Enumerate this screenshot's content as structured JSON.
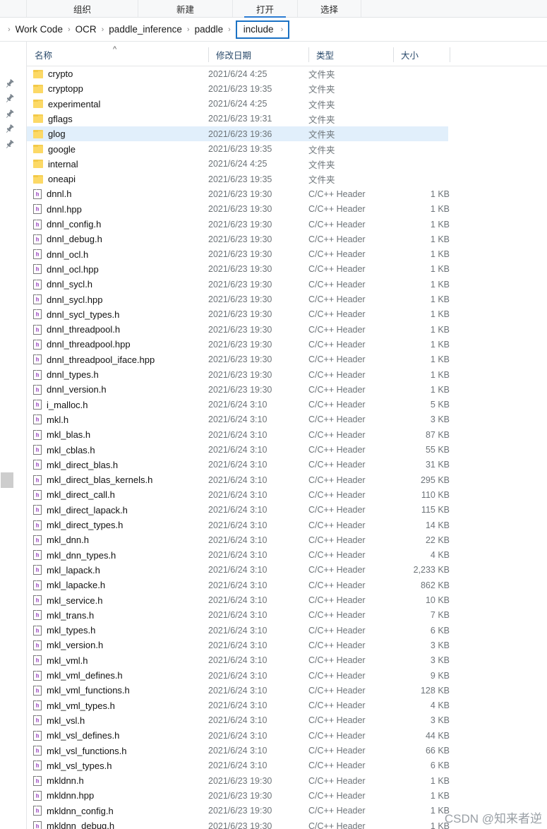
{
  "ribbon": {
    "tabs": [
      {
        "label": "组织",
        "active": false
      },
      {
        "label": "新建",
        "active": false
      },
      {
        "label": "打开",
        "active": true
      },
      {
        "label": "选择",
        "active": false
      }
    ]
  },
  "breadcrumb": {
    "separator": "›",
    "items": [
      "Work Code",
      "OCR",
      "paddle_inference",
      "paddle"
    ],
    "current": "include",
    "highlight_color": "#1b72c4"
  },
  "columns": {
    "name": "名称",
    "date": "修改日期",
    "type": "类型",
    "size": "大小",
    "sort_caret": "^"
  },
  "left_rail": {
    "pin_icon": "pin-icon",
    "pin_count": 5
  },
  "selection": {
    "row": "glog",
    "color": "#e1effb"
  },
  "types": {
    "folder": "文件夹",
    "header": "C/C++ Header"
  },
  "rows": [
    {
      "name": "crypto",
      "date": "2021/6/24 4:25",
      "type": "文件夹",
      "size": "",
      "kind": "folder"
    },
    {
      "name": "cryptopp",
      "date": "2021/6/23 19:35",
      "type": "文件夹",
      "size": "",
      "kind": "folder"
    },
    {
      "name": "experimental",
      "date": "2021/6/24 4:25",
      "type": "文件夹",
      "size": "",
      "kind": "folder"
    },
    {
      "name": "gflags",
      "date": "2021/6/23 19:31",
      "type": "文件夹",
      "size": "",
      "kind": "folder"
    },
    {
      "name": "glog",
      "date": "2021/6/23 19:36",
      "type": "文件夹",
      "size": "",
      "kind": "folder",
      "selected": true
    },
    {
      "name": "google",
      "date": "2021/6/23 19:35",
      "type": "文件夹",
      "size": "",
      "kind": "folder"
    },
    {
      "name": "internal",
      "date": "2021/6/24 4:25",
      "type": "文件夹",
      "size": "",
      "kind": "folder"
    },
    {
      "name": "oneapi",
      "date": "2021/6/23 19:35",
      "type": "文件夹",
      "size": "",
      "kind": "folder"
    },
    {
      "name": "dnnl.h",
      "date": "2021/6/23 19:30",
      "type": "C/C++ Header",
      "size": "1 KB",
      "kind": "header"
    },
    {
      "name": "dnnl.hpp",
      "date": "2021/6/23 19:30",
      "type": "C/C++ Header",
      "size": "1 KB",
      "kind": "header"
    },
    {
      "name": "dnnl_config.h",
      "date": "2021/6/23 19:30",
      "type": "C/C++ Header",
      "size": "1 KB",
      "kind": "header"
    },
    {
      "name": "dnnl_debug.h",
      "date": "2021/6/23 19:30",
      "type": "C/C++ Header",
      "size": "1 KB",
      "kind": "header"
    },
    {
      "name": "dnnl_ocl.h",
      "date": "2021/6/23 19:30",
      "type": "C/C++ Header",
      "size": "1 KB",
      "kind": "header"
    },
    {
      "name": "dnnl_ocl.hpp",
      "date": "2021/6/23 19:30",
      "type": "C/C++ Header",
      "size": "1 KB",
      "kind": "header"
    },
    {
      "name": "dnnl_sycl.h",
      "date": "2021/6/23 19:30",
      "type": "C/C++ Header",
      "size": "1 KB",
      "kind": "header"
    },
    {
      "name": "dnnl_sycl.hpp",
      "date": "2021/6/23 19:30",
      "type": "C/C++ Header",
      "size": "1 KB",
      "kind": "header"
    },
    {
      "name": "dnnl_sycl_types.h",
      "date": "2021/6/23 19:30",
      "type": "C/C++ Header",
      "size": "1 KB",
      "kind": "header"
    },
    {
      "name": "dnnl_threadpool.h",
      "date": "2021/6/23 19:30",
      "type": "C/C++ Header",
      "size": "1 KB",
      "kind": "header"
    },
    {
      "name": "dnnl_threadpool.hpp",
      "date": "2021/6/23 19:30",
      "type": "C/C++ Header",
      "size": "1 KB",
      "kind": "header"
    },
    {
      "name": "dnnl_threadpool_iface.hpp",
      "date": "2021/6/23 19:30",
      "type": "C/C++ Header",
      "size": "1 KB",
      "kind": "header"
    },
    {
      "name": "dnnl_types.h",
      "date": "2021/6/23 19:30",
      "type": "C/C++ Header",
      "size": "1 KB",
      "kind": "header"
    },
    {
      "name": "dnnl_version.h",
      "date": "2021/6/23 19:30",
      "type": "C/C++ Header",
      "size": "1 KB",
      "kind": "header"
    },
    {
      "name": "i_malloc.h",
      "date": "2021/6/24 3:10",
      "type": "C/C++ Header",
      "size": "5 KB",
      "kind": "header"
    },
    {
      "name": "mkl.h",
      "date": "2021/6/24 3:10",
      "type": "C/C++ Header",
      "size": "3 KB",
      "kind": "header"
    },
    {
      "name": "mkl_blas.h",
      "date": "2021/6/24 3:10",
      "type": "C/C++ Header",
      "size": "87 KB",
      "kind": "header"
    },
    {
      "name": "mkl_cblas.h",
      "date": "2021/6/24 3:10",
      "type": "C/C++ Header",
      "size": "55 KB",
      "kind": "header"
    },
    {
      "name": "mkl_direct_blas.h",
      "date": "2021/6/24 3:10",
      "type": "C/C++ Header",
      "size": "31 KB",
      "kind": "header"
    },
    {
      "name": "mkl_direct_blas_kernels.h",
      "date": "2021/6/24 3:10",
      "type": "C/C++ Header",
      "size": "295 KB",
      "kind": "header"
    },
    {
      "name": "mkl_direct_call.h",
      "date": "2021/6/24 3:10",
      "type": "C/C++ Header",
      "size": "110 KB",
      "kind": "header"
    },
    {
      "name": "mkl_direct_lapack.h",
      "date": "2021/6/24 3:10",
      "type": "C/C++ Header",
      "size": "115 KB",
      "kind": "header"
    },
    {
      "name": "mkl_direct_types.h",
      "date": "2021/6/24 3:10",
      "type": "C/C++ Header",
      "size": "14 KB",
      "kind": "header"
    },
    {
      "name": "mkl_dnn.h",
      "date": "2021/6/24 3:10",
      "type": "C/C++ Header",
      "size": "22 KB",
      "kind": "header"
    },
    {
      "name": "mkl_dnn_types.h",
      "date": "2021/6/24 3:10",
      "type": "C/C++ Header",
      "size": "4 KB",
      "kind": "header"
    },
    {
      "name": "mkl_lapack.h",
      "date": "2021/6/24 3:10",
      "type": "C/C++ Header",
      "size": "2,233 KB",
      "kind": "header"
    },
    {
      "name": "mkl_lapacke.h",
      "date": "2021/6/24 3:10",
      "type": "C/C++ Header",
      "size": "862 KB",
      "kind": "header"
    },
    {
      "name": "mkl_service.h",
      "date": "2021/6/24 3:10",
      "type": "C/C++ Header",
      "size": "10 KB",
      "kind": "header"
    },
    {
      "name": "mkl_trans.h",
      "date": "2021/6/24 3:10",
      "type": "C/C++ Header",
      "size": "7 KB",
      "kind": "header"
    },
    {
      "name": "mkl_types.h",
      "date": "2021/6/24 3:10",
      "type": "C/C++ Header",
      "size": "6 KB",
      "kind": "header"
    },
    {
      "name": "mkl_version.h",
      "date": "2021/6/24 3:10",
      "type": "C/C++ Header",
      "size": "3 KB",
      "kind": "header"
    },
    {
      "name": "mkl_vml.h",
      "date": "2021/6/24 3:10",
      "type": "C/C++ Header",
      "size": "3 KB",
      "kind": "header"
    },
    {
      "name": "mkl_vml_defines.h",
      "date": "2021/6/24 3:10",
      "type": "C/C++ Header",
      "size": "9 KB",
      "kind": "header"
    },
    {
      "name": "mkl_vml_functions.h",
      "date": "2021/6/24 3:10",
      "type": "C/C++ Header",
      "size": "128 KB",
      "kind": "header"
    },
    {
      "name": "mkl_vml_types.h",
      "date": "2021/6/24 3:10",
      "type": "C/C++ Header",
      "size": "4 KB",
      "kind": "header"
    },
    {
      "name": "mkl_vsl.h",
      "date": "2021/6/24 3:10",
      "type": "C/C++ Header",
      "size": "3 KB",
      "kind": "header"
    },
    {
      "name": "mkl_vsl_defines.h",
      "date": "2021/6/24 3:10",
      "type": "C/C++ Header",
      "size": "44 KB",
      "kind": "header"
    },
    {
      "name": "mkl_vsl_functions.h",
      "date": "2021/6/24 3:10",
      "type": "C/C++ Header",
      "size": "66 KB",
      "kind": "header"
    },
    {
      "name": "mkl_vsl_types.h",
      "date": "2021/6/24 3:10",
      "type": "C/C++ Header",
      "size": "6 KB",
      "kind": "header"
    },
    {
      "name": "mkldnn.h",
      "date": "2021/6/23 19:30",
      "type": "C/C++ Header",
      "size": "1 KB",
      "kind": "header"
    },
    {
      "name": "mkldnn.hpp",
      "date": "2021/6/23 19:30",
      "type": "C/C++ Header",
      "size": "1 KB",
      "kind": "header"
    },
    {
      "name": "mkldnn_config.h",
      "date": "2021/6/23 19:30",
      "type": "C/C++ Header",
      "size": "1 KB",
      "kind": "header"
    },
    {
      "name": "mkldnn_debug.h",
      "date": "2021/6/23 19:30",
      "type": "C/C++ Header",
      "size": "1 KB",
      "kind": "header"
    }
  ],
  "watermark": {
    "text": "CSDN @知来者逆"
  }
}
